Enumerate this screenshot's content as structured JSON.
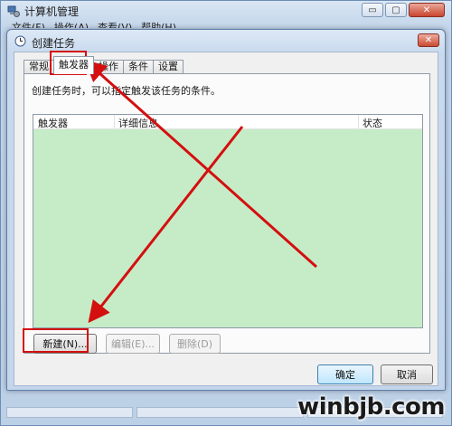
{
  "background_window": {
    "title": "计算机管理",
    "menu": [
      "文件(F)",
      "操作(A)",
      "查看(V)",
      "帮助(H)"
    ],
    "controls": {
      "minimize": "▭",
      "maximize": "▢",
      "close": "✕"
    }
  },
  "dialog": {
    "title": "创建任务",
    "close_glyph": "✕",
    "tabs": [
      {
        "label": "常规"
      },
      {
        "label": "触发器",
        "active": true
      },
      {
        "label": "操作"
      },
      {
        "label": "条件"
      },
      {
        "label": "设置"
      }
    ],
    "description": "创建任务时，可以指定触发该任务的条件。",
    "list": {
      "columns": [
        "触发器",
        "详细信息",
        "状态"
      ],
      "rows": [],
      "area_color": "#c6ecc7"
    },
    "buttons": {
      "new": "新建(N)...",
      "edit": "编辑(E)...",
      "delete": "删除(D)",
      "ok": "确定",
      "cancel": "取消"
    }
  },
  "annotation": {
    "color": "#d40f0f",
    "icons": [
      "red-arrow",
      "red-cross-line"
    ]
  },
  "watermark": "winbjb.com"
}
